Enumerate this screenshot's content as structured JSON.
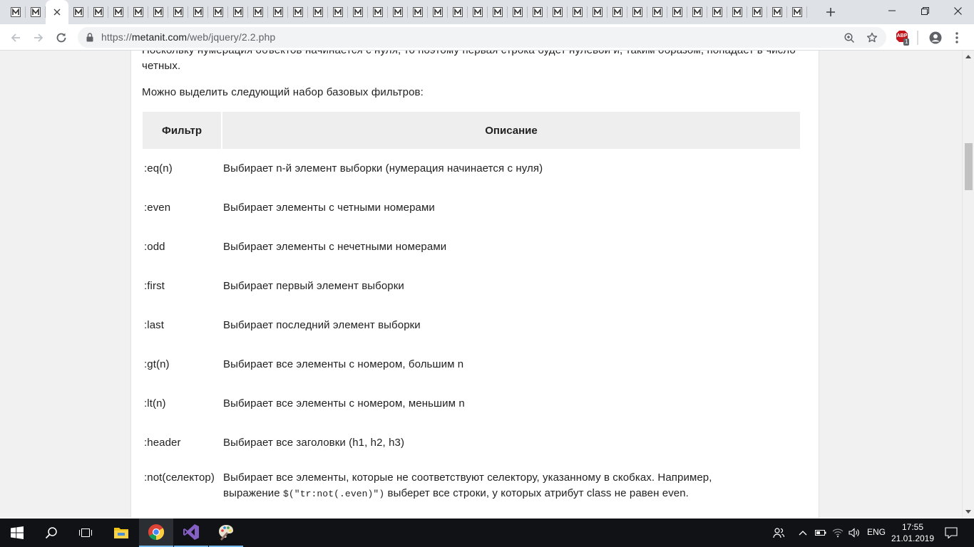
{
  "browser": {
    "background_tab_count": 39,
    "active_tab_index": 2,
    "new_tab_label": "+",
    "url_prefix": "https://",
    "url_host": "metanit.com",
    "url_path": "/web/jquery/2.2.php",
    "extension_badge": "1",
    "extension_label": "ABP"
  },
  "page": {
    "paragraph_top": "Поскольку нумерация объектов начинается с нуля, то поэтому первая строка будет нулевой и, таким образом, попадает в число четных.",
    "paragraph_intro": "Можно выделить следующий набор базовых фильтров:",
    "table": {
      "header_filter": "Фильтр",
      "header_description": "Описание",
      "rows": [
        {
          "filter": ":eq(n)",
          "description": "Выбирает n-й элемент выборки (нумерация начинается с нуля)"
        },
        {
          "filter": ":even",
          "description": "Выбирает элементы с четными номерами"
        },
        {
          "filter": ":odd",
          "description": "Выбирает элементы с нечетными номерами"
        },
        {
          "filter": ":first",
          "description": "Выбирает первый элемент выборки"
        },
        {
          "filter": ":last",
          "description": "Выбирает последний элемент выборки"
        },
        {
          "filter": ":gt(n)",
          "description": "Выбирает все элементы с номером, большим n"
        },
        {
          "filter": ":lt(n)",
          "description": "Выбирает все элементы с номером, меньшим n"
        },
        {
          "filter": ":header",
          "description": "Выбирает все заголовки (h1, h2, h3)"
        }
      ],
      "last_row": {
        "filter": ":not(селектор)",
        "desc_line1": "Выбирает все элементы, которые не соответствуют селектору, указанному в скобках. Например,",
        "desc_line2_pre": "выражение",
        "desc_line2_code": "$(\"tr:not(.even)\")",
        "desc_line2_post": "выберет все строки, у которых атрибут class не равен even."
      }
    }
  },
  "taskbar": {
    "language": "ENG",
    "time": "17:55",
    "date": "21.01.2019"
  },
  "colors": {
    "tabstrip": "#dee1e6",
    "taskbar": "#101216",
    "table_header": "#eeeeee",
    "accent": "#76b9ed"
  }
}
